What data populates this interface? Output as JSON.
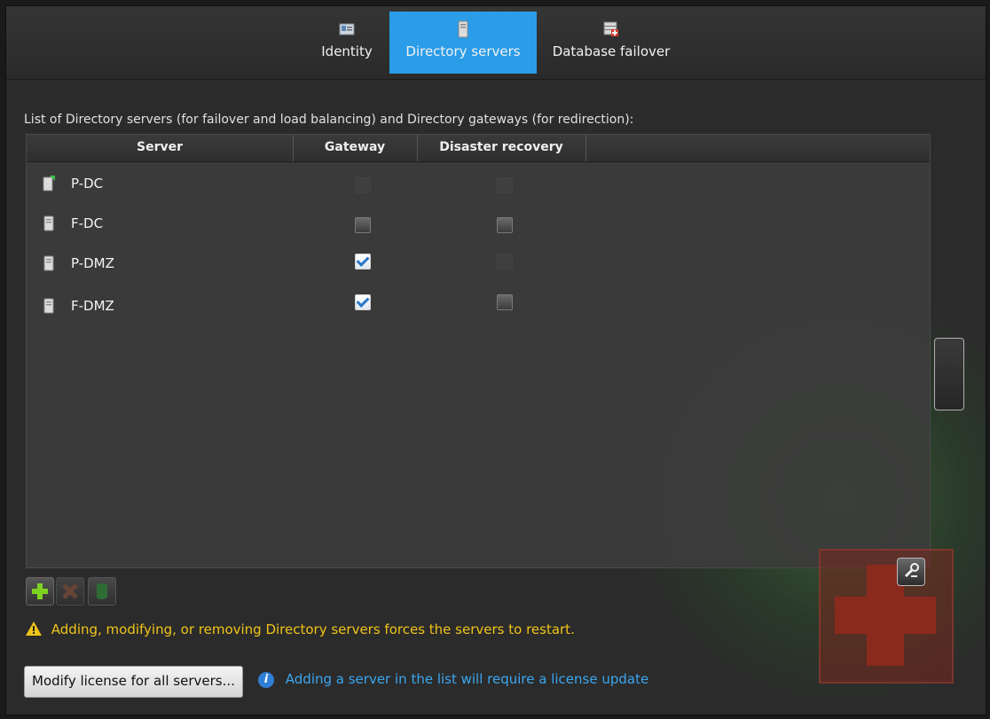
{
  "tabs": [
    {
      "label": "Identity",
      "icon": "identity-card-icon",
      "active": false
    },
    {
      "label": "Directory servers",
      "icon": "server-icon",
      "active": true
    },
    {
      "label": "Database failover",
      "icon": "database-failover-icon",
      "active": false
    }
  ],
  "description": "List of Directory servers (for failover and load balancing) and Directory gateways (for redirection):",
  "table": {
    "headers": {
      "server": "Server",
      "gateway": "Gateway",
      "disaster_recovery": "Disaster recovery"
    },
    "rows": [
      {
        "name": "P-DC",
        "icon": "primary-server-icon",
        "gateway": null,
        "disaster_recovery": null
      },
      {
        "name": "F-DC",
        "icon": "server-icon",
        "gateway": false,
        "disaster_recovery": false
      },
      {
        "name": "P-DMZ",
        "icon": "server-icon",
        "gateway": true,
        "disaster_recovery": null
      },
      {
        "name": "F-DMZ",
        "icon": "server-icon",
        "gateway": true,
        "disaster_recovery": false
      }
    ]
  },
  "warning": "Adding, modifying, or removing Directory servers forces the servers to restart.",
  "modify_button": "Modify license for all servers...",
  "info": "Adding a server in the list will require a license update",
  "colors": {
    "accent": "#2a9ce8",
    "warning": "#f0c419",
    "info": "#3ba6f0"
  }
}
